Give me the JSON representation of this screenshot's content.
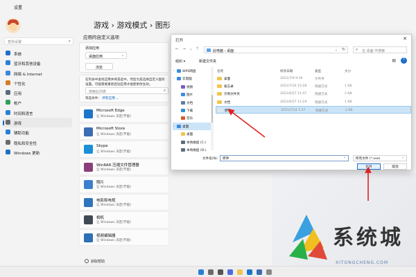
{
  "app": {
    "window_title": "设置"
  },
  "nav": {
    "search_placeholder": "查找设置",
    "items": [
      {
        "label": "系统",
        "color": "#1f6fc8"
      },
      {
        "label": "蓝牙和其他设备",
        "color": "#2a7fd6"
      },
      {
        "label": "网络 & Internet",
        "color": "#3a88d9"
      },
      {
        "label": "个性化",
        "color": "#d97a2a"
      },
      {
        "label": "应用",
        "color": "#5a6b7e"
      },
      {
        "label": "帐户",
        "color": "#2e9e5b"
      },
      {
        "label": "时间和语言",
        "color": "#2a7fd6"
      },
      {
        "label": "游戏",
        "color": "#6b6b6b"
      },
      {
        "label": "辅助功能",
        "color": "#2a7fd6"
      },
      {
        "label": "隐私和安全性",
        "color": "#6b6b6b"
      },
      {
        "label": "Windows 更新",
        "color": "#1f6fc8"
      }
    ],
    "active_index": 7
  },
  "breadcrumb": "游戏  ›  游戏模式  ›  图形",
  "main": {
    "section_title": "应用的自定义选项",
    "add_app_label": "添加应用",
    "add_app_value": "桌面应用",
    "browse_label": "浏览",
    "find_desc": "在列表中查找应用并将其选中，然后为其选择自定义图形设置。可能需要重新启动应用才能使更改生效。",
    "search_placeholder": "搜索此列表",
    "filter_label": "筛选条件：",
    "filter_value": "所有应用 ⌄",
    "apps": [
      {
        "name": "Microsoft Edge",
        "sub": "让 Windows 决定(节能)",
        "color": "#1d74c9"
      },
      {
        "name": "Microsoft Store",
        "sub": "让 Windows 决定(节能)",
        "color": "#3b6db3"
      },
      {
        "name": "Skype",
        "sub": "让 Windows 决定(节能)",
        "color": "#1b8fd8"
      },
      {
        "name": "WinRAR 压缩文件管理器",
        "sub": "让 Windows 决定(节能)",
        "color": "#8a3f7a"
      },
      {
        "name": "照片",
        "sub": "让 Windows 决定(节能)",
        "color": "#3d7fcc"
      },
      {
        "name": "电影和电视",
        "sub": "让 Windows 决定(节能)",
        "color": "#2f74bd"
      },
      {
        "name": "相机",
        "sub": "让 Windows 决定(节能)",
        "color": "#404a56"
      },
      {
        "name": "视频编辑器",
        "sub": "让 Windows 决定(节能)",
        "color": "#2f6fb5"
      }
    ],
    "help_label": "获取帮助"
  },
  "dialog": {
    "title": "打开",
    "close": "✕",
    "address": "此电脑 › 桌面",
    "search_placeholder": "在 桌面 中搜索",
    "organize": "组织 ▾",
    "new_folder": "新建文件夹",
    "tree": [
      {
        "label": "WPS网盘",
        "color": "#3b8be0",
        "child": false,
        "selected": false
      },
      {
        "label": "云电脑",
        "color": "#3b8be0",
        "child": false,
        "selected": false
      },
      {
        "label": "视频",
        "color": "#7a5ac7",
        "child": true,
        "selected": false
      },
      {
        "label": "图片",
        "color": "#3b8be0",
        "child": true,
        "selected": false
      },
      {
        "label": "文档",
        "color": "#5b7ea8",
        "child": true,
        "selected": false
      },
      {
        "label": "下载",
        "color": "#2e8fd6",
        "child": true,
        "selected": false
      },
      {
        "label": "音乐",
        "color": "#d65a2e",
        "child": true,
        "selected": false
      },
      {
        "label": "桌面",
        "color": "#3b8be0",
        "child": false,
        "selected": true
      },
      {
        "label": "桌面",
        "color": "#f2c350",
        "child": true,
        "selected": false
      },
      {
        "label": "本地磁盘 (C:)",
        "color": "#5b6e80",
        "child": true,
        "selected": false
      },
      {
        "label": "本地磁盘 (D:)",
        "color": "#5b6e80",
        "child": true,
        "selected": false
      }
    ],
    "columns": {
      "name": "名称",
      "date": "修改日期",
      "type": "类型",
      "size": "大小"
    },
    "files": [
      {
        "name": "桌面",
        "date": "2021/7/9 9:36",
        "type": "文件夹",
        "size": "",
        "color": "#f2c350",
        "selected": false
      },
      {
        "name": "备忘录",
        "date": "2021/7/10 15:28",
        "type": "快捷方式",
        "size": "1 KB",
        "color": "#f2c350",
        "selected": false
      },
      {
        "name": "示例文件夹",
        "date": "2021/6/27 11:47",
        "type": "快捷方式",
        "size": "2 KB",
        "color": "#f2c350",
        "selected": false
      },
      {
        "name": "文档",
        "date": "2021/6/27 11:19",
        "type": "快捷方式",
        "size": "1 KB",
        "color": "#f2c350",
        "selected": false
      },
      {
        "name": "原神",
        "date": "2021/7/14 7:37",
        "type": "快捷方式",
        "size": "2 KB",
        "color": "#e0e6ea",
        "selected": true
      }
    ],
    "filename_label": "文件名(N):",
    "filename_value": "原神",
    "filetype_value": "所有文件 (*.exe)",
    "open_label": "打开",
    "cancel_label": "取消"
  },
  "watermark": {
    "text": "系统城",
    "sub": "XITONGCHENG.COM"
  }
}
